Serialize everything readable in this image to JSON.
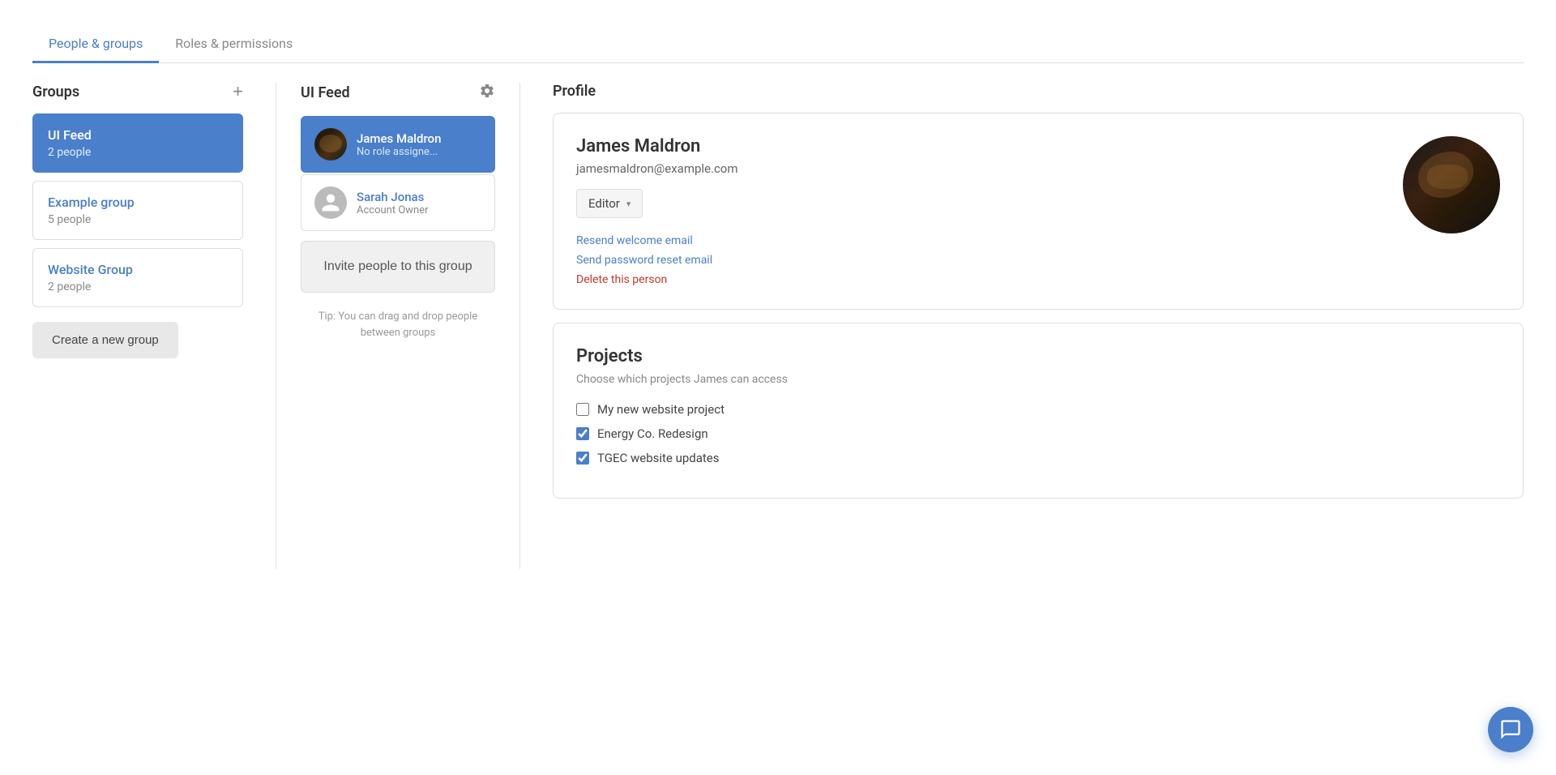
{
  "tabs": [
    {
      "id": "people-groups",
      "label": "People & groups",
      "active": true
    },
    {
      "id": "roles-permissions",
      "label": "Roles & permissions",
      "active": false
    }
  ],
  "groups": {
    "title": "Groups",
    "add_button_label": "+",
    "items": [
      {
        "id": "ui-feed",
        "name": "UI Feed",
        "count": "2 people",
        "active": true
      },
      {
        "id": "example-group",
        "name": "Example group",
        "count": "5 people",
        "active": false
      },
      {
        "id": "website-group",
        "name": "Website Group",
        "count": "2 people",
        "active": false
      }
    ],
    "create_button_label": "Create a new group"
  },
  "feed": {
    "title": "UI Feed",
    "gear_label": "Settings",
    "members": [
      {
        "id": "james-maldron",
        "name": "James Maldron",
        "role": "No role assigne...",
        "active": true,
        "has_photo": true
      },
      {
        "id": "sarah-jonas",
        "name": "Sarah Jonas",
        "role": "Account Owner",
        "active": false,
        "has_photo": false
      }
    ],
    "invite_button_label": "Invite people to this group",
    "tip_text": "Tip: You can drag and drop people between groups"
  },
  "profile": {
    "title": "Profile",
    "name": "James Maldron",
    "email": "jamesmaldron@example.com",
    "role": "Editor",
    "role_dropdown_arrow": "▾",
    "actions": [
      {
        "id": "resend-welcome",
        "label": "Resend welcome email",
        "type": "normal"
      },
      {
        "id": "send-password-reset",
        "label": "Send password reset email",
        "type": "normal"
      },
      {
        "id": "delete-person",
        "label": "Delete this person",
        "type": "danger"
      }
    ]
  },
  "projects": {
    "title": "Projects",
    "subtitle_prefix": "Choose which projects",
    "subtitle_name": "James",
    "subtitle_suffix": "can access",
    "items": [
      {
        "id": "my-new-website",
        "label": "My new website project",
        "checked": false
      },
      {
        "id": "energy-co",
        "label": "Energy Co. Redesign",
        "checked": true
      },
      {
        "id": "tgec-website",
        "label": "TGEC website updates",
        "checked": true
      }
    ]
  },
  "chat": {
    "button_label": "Chat"
  }
}
